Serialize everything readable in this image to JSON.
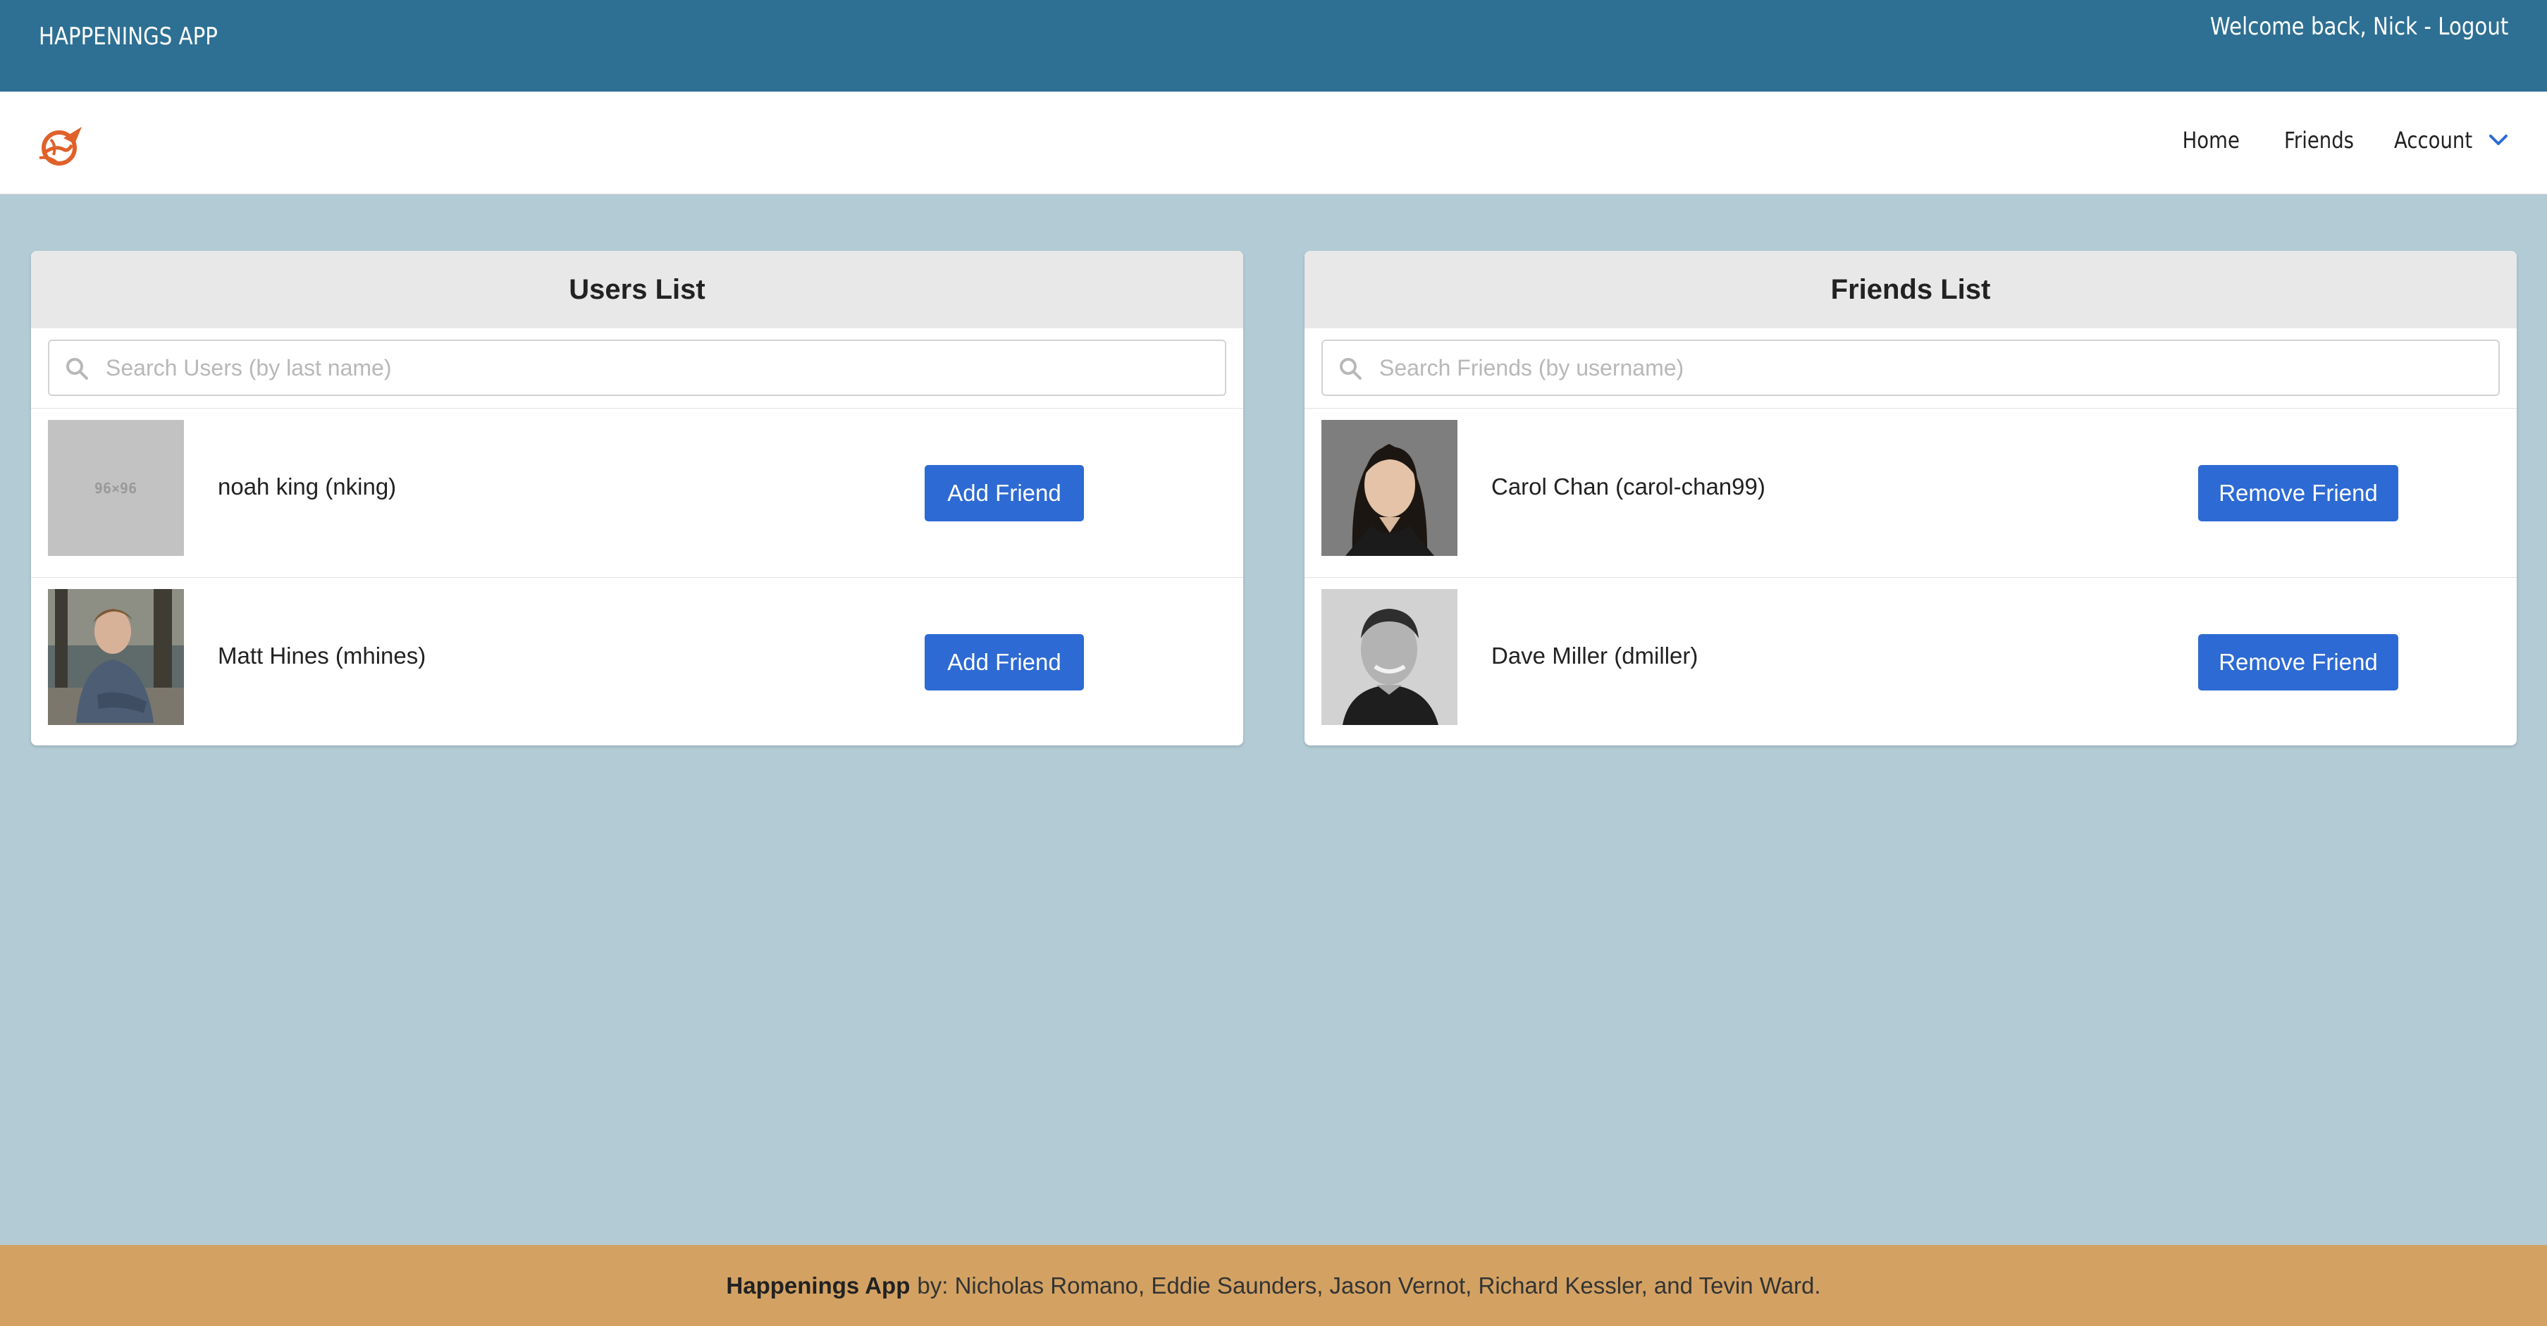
{
  "topbar": {
    "app_title": "HAPPENINGS APP",
    "welcome": "Welcome back, Nick",
    "separator": " - ",
    "logout": "Logout"
  },
  "nav": {
    "logo_icon": "rocket-globe-logo",
    "home": "Home",
    "friends": "Friends",
    "account": "Account"
  },
  "users_panel": {
    "title": "Users List",
    "search_placeholder": "Search Users (by last name)",
    "search_value": "",
    "rows": [
      {
        "name": "noah king (nking)",
        "avatar_placeholder": "96×96",
        "button": "Add Friend"
      },
      {
        "name": "Matt Hines (mhines)",
        "button": "Add Friend"
      }
    ]
  },
  "friends_panel": {
    "title": "Friends List",
    "search_placeholder": "Search Friends (by username)",
    "search_value": "",
    "rows": [
      {
        "name": "Carol Chan (carol-chan99)",
        "button": "Remove Friend"
      },
      {
        "name": "Dave Miller (dmiller)",
        "button": "Remove Friend"
      }
    ]
  },
  "footer": {
    "brand": "Happenings App",
    "credits": "by: Nicholas Romano, Eddie Saunders, Jason Vernot, Richard Kessler, and Tevin Ward."
  },
  "colors": {
    "topbar": "#2e7094",
    "page_bg": "#b2cbd5",
    "button": "#2d6ad3",
    "footer": "#d3a263",
    "logo": "#e0612a"
  }
}
